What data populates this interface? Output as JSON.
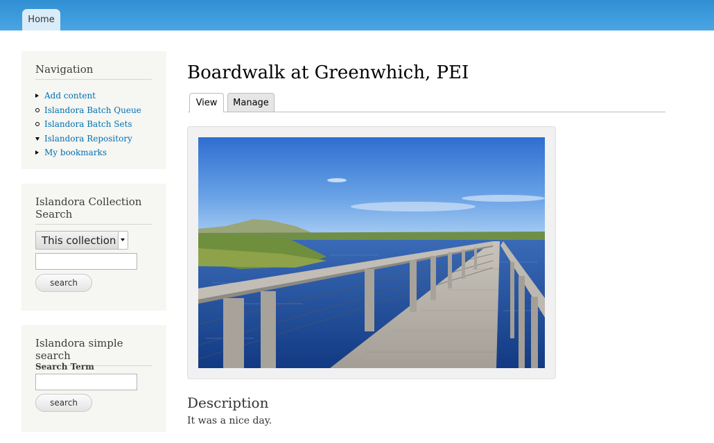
{
  "header": {
    "home_tab": "Home"
  },
  "sidebar": {
    "navigation": {
      "title": "Navigation",
      "items": [
        {
          "label": "Add content",
          "bullet": "collapsed"
        },
        {
          "label": "Islandora Batch Queue",
          "bullet": "leaf"
        },
        {
          "label": "Islandora Batch Sets",
          "bullet": "leaf"
        },
        {
          "label": "Islandora Repository",
          "bullet": "expanded"
        },
        {
          "label": "My bookmarks",
          "bullet": "collapsed"
        }
      ]
    },
    "collection_search": {
      "title": "Islandora Collection Search",
      "select_value": "This collection",
      "input_value": "",
      "button_label": "search"
    },
    "simple_search": {
      "title": "Islandora simple search",
      "field_label": "Search Term",
      "input_value": "",
      "button_label": "search"
    }
  },
  "main": {
    "title": "Boardwalk at Greenwhich, PEI",
    "tabs": [
      {
        "label": "View",
        "active": true
      },
      {
        "label": "Manage",
        "active": false
      }
    ],
    "image": {
      "subject": "boardwalk-over-water-photo"
    },
    "description_heading": "Description",
    "description_text": "It was a nice day."
  },
  "colors": {
    "header_top": "#2f8fd3",
    "header_bottom": "#4aa6e3",
    "link": "#0071b3",
    "sidebar_bg": "#f6f6f2"
  }
}
